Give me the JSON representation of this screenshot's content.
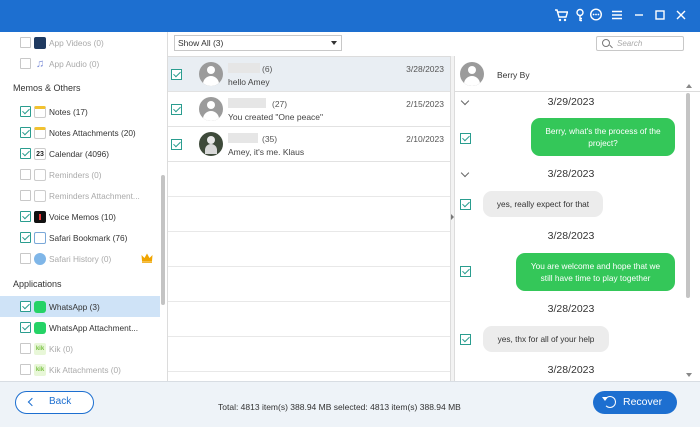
{
  "colors": {
    "titlebar": "#1d6fd0",
    "checkbox": "#2a9d8f",
    "bubble_outgoing": "#34c759",
    "bubble_incoming": "#ececec",
    "accent": "#1d6fd0"
  },
  "titlebar_icons": [
    "cart-icon",
    "key-icon",
    "chat-support-icon",
    "menu-icon",
    "minimize-icon",
    "maximize-icon",
    "close-icon"
  ],
  "sidebar": {
    "items_top": [
      {
        "label": "App Videos (0)",
        "icon": "video-icon",
        "checked": false,
        "disabled": true
      },
      {
        "label": "App Audio (0)",
        "icon": "audio-icon",
        "checked": false,
        "disabled": true
      }
    ],
    "memos_heading": "Memos & Others",
    "memos": [
      {
        "label": "Notes (17)",
        "icon": "notes-icon",
        "checked": true,
        "disabled": false
      },
      {
        "label": "Notes Attachments (20)",
        "icon": "notes-attachments-icon",
        "checked": true,
        "disabled": false
      },
      {
        "label": "Calendar (4096)",
        "icon": "calendar-icon",
        "checked": true,
        "disabled": false
      },
      {
        "label": "Reminders (0)",
        "icon": "reminders-icon",
        "checked": false,
        "disabled": true
      },
      {
        "label": "Reminders Attachment...",
        "icon": "reminders-attachment-icon",
        "checked": false,
        "disabled": true
      },
      {
        "label": "Voice Memos (10)",
        "icon": "voice-memos-icon",
        "checked": true,
        "disabled": false
      },
      {
        "label": "Safari Bookmark (76)",
        "icon": "safari-bookmark-icon",
        "checked": true,
        "disabled": false
      },
      {
        "label": "Safari History (0)",
        "icon": "safari-history-icon",
        "checked": false,
        "disabled": true
      }
    ],
    "apps_heading": "Applications",
    "apps": [
      {
        "label": "WhatsApp (3)",
        "icon": "whatsapp-icon",
        "checked": true,
        "disabled": false,
        "selected": true
      },
      {
        "label": "WhatsApp Attachment...",
        "icon": "whatsapp-attachment-icon",
        "checked": true,
        "disabled": false
      },
      {
        "label": "Kik (0)",
        "icon": "kik-icon",
        "checked": false,
        "disabled": true
      },
      {
        "label": "Kik Attachments (0)",
        "icon": "kik-attachments-icon",
        "checked": false,
        "disabled": true
      }
    ]
  },
  "toolbar": {
    "filter_value": "Show All (3)",
    "search_placeholder": "Search"
  },
  "conversations": [
    {
      "count": "(6)",
      "date": "3/28/2023",
      "preview": "hello Amey",
      "selected": true,
      "photo": false
    },
    {
      "count": "(27)",
      "date": "2/15/2023",
      "preview": "You created \"One peace\"",
      "selected": false,
      "photo": false
    },
    {
      "count": "(35)",
      "date": "2/10/2023",
      "preview": "Amey, it's me. Klaus",
      "selected": false,
      "photo": true
    }
  ],
  "chat": {
    "contact_name": "Berry By",
    "blocks": [
      {
        "date": "3/29/2023",
        "chevron": true,
        "message": "Berry, what's the process of the project?",
        "direction": "out"
      },
      {
        "date": "3/28/2023",
        "chevron": true,
        "message": "yes, really expect for that",
        "direction": "in"
      },
      {
        "date": "3/28/2023",
        "chevron": false,
        "message": "You are welcome and hope that we still have time to play together",
        "direction": "out"
      },
      {
        "date": "3/28/2023",
        "chevron": false,
        "message": "yes, thx for all of your help",
        "direction": "in"
      },
      {
        "date": "3/28/2023",
        "chevron": false,
        "message": "",
        "direction": ""
      }
    ]
  },
  "footer": {
    "back_label": "Back",
    "status": "Total: 4813 item(s) 388.94 MB   selected: 4813 item(s) 388.94 MB",
    "recover_label": "Recover"
  }
}
